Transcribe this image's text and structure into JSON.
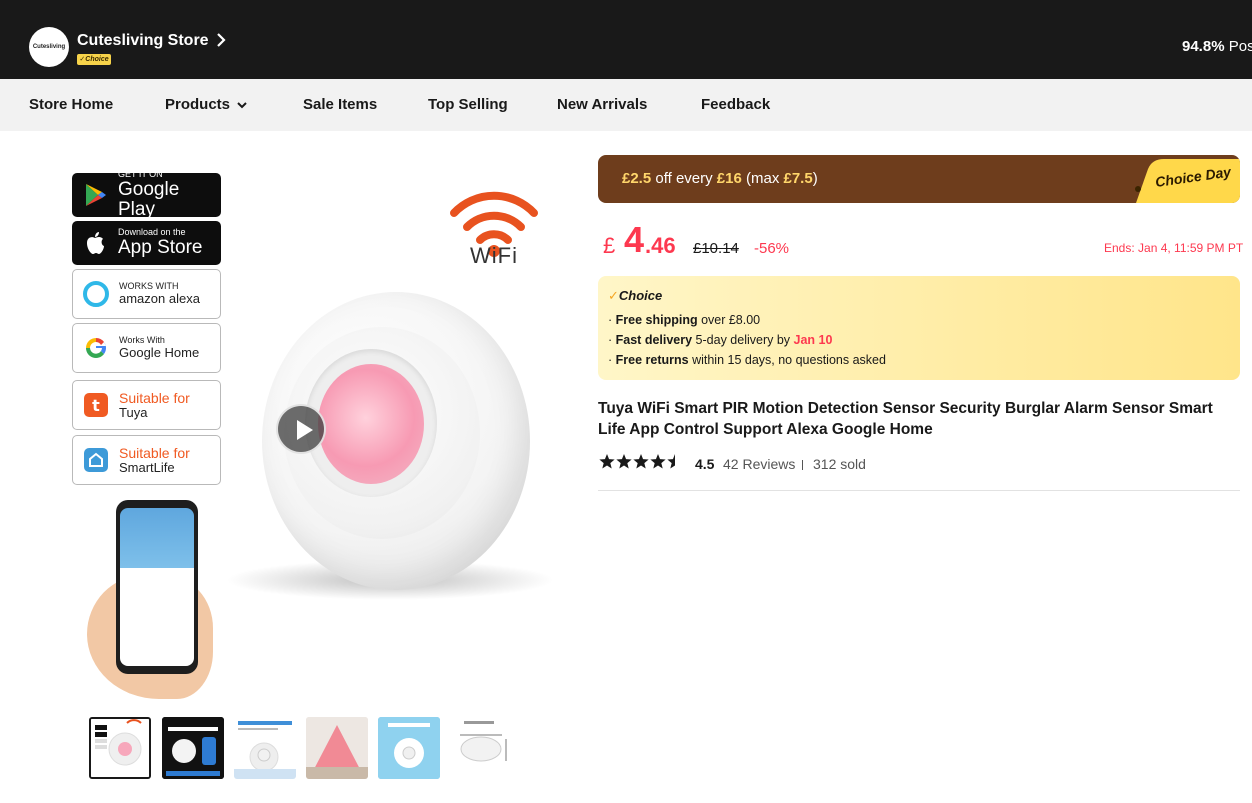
{
  "store": {
    "logo_text": "Cutesliving",
    "name": "Cutesliving Store",
    "choice_badge": "Choice",
    "positive_pct": "94.8%",
    "positive_suffix": "Pos"
  },
  "nav": {
    "items": [
      {
        "label": "Store Home"
      },
      {
        "label": "Products"
      },
      {
        "label": "Sale Items"
      },
      {
        "label": "Top Selling"
      },
      {
        "label": "New Arrivals"
      },
      {
        "label": "Feedback"
      }
    ]
  },
  "gallery": {
    "badges": {
      "google_play_small": "GET IT ON",
      "google_play_big": "Google Play",
      "app_store_small": "Download on the",
      "app_store_big": "App Store",
      "alexa_small": "WORKS WITH",
      "alexa_big": "amazon alexa",
      "google_home_small": "Works With",
      "google_home_big": "Google Home",
      "tuya_top": "Suitable for",
      "tuya_bottom": "Tuya",
      "smartlife_top": "Suitable for",
      "smartlife_bottom": "SmartLife"
    },
    "wifi_label": "WiFi",
    "thumbnails": [
      {
        "selected": true
      },
      {
        "selected": false
      },
      {
        "selected": false
      },
      {
        "selected": false
      },
      {
        "selected": false
      },
      {
        "selected": false
      }
    ]
  },
  "promo": {
    "currency": "£",
    "off_amount": "2.5",
    "text_mid": " off every ",
    "every_amount": "16",
    "text_max": " (max ",
    "max_amount": "7.5",
    "text_end": ")",
    "badge": "Choice Day"
  },
  "price": {
    "symbol": "£",
    "integer": "4",
    "decimal": ".46",
    "original": "£10.14",
    "discount": "-56%",
    "ends": "Ends: Jan 4, 11:59 PM PT"
  },
  "choice": {
    "logo": "Choice",
    "shipping_bold": "Free shipping",
    "shipping_rest": " over £8.00",
    "delivery_bold": "Fast delivery",
    "delivery_rest": " 5-day delivery by ",
    "delivery_date": "Jan 10",
    "returns_bold": "Free returns",
    "returns_rest": "  within 15 days, no questions asked"
  },
  "product": {
    "title": "Tuya WiFi Smart PIR Motion Detection Sensor Security Burglar Alarm Sensor Smart Life App Control Support Alexa Google Home",
    "rating": "4.5",
    "reviews": "42 Reviews",
    "sold": "312 sold",
    "stars_value": 4.5
  },
  "colors": {
    "accent_red": "#fd384f",
    "promo_brown": "#6e3d1c",
    "choice_yellow": "#ffe58a",
    "header_dark": "#191919"
  }
}
